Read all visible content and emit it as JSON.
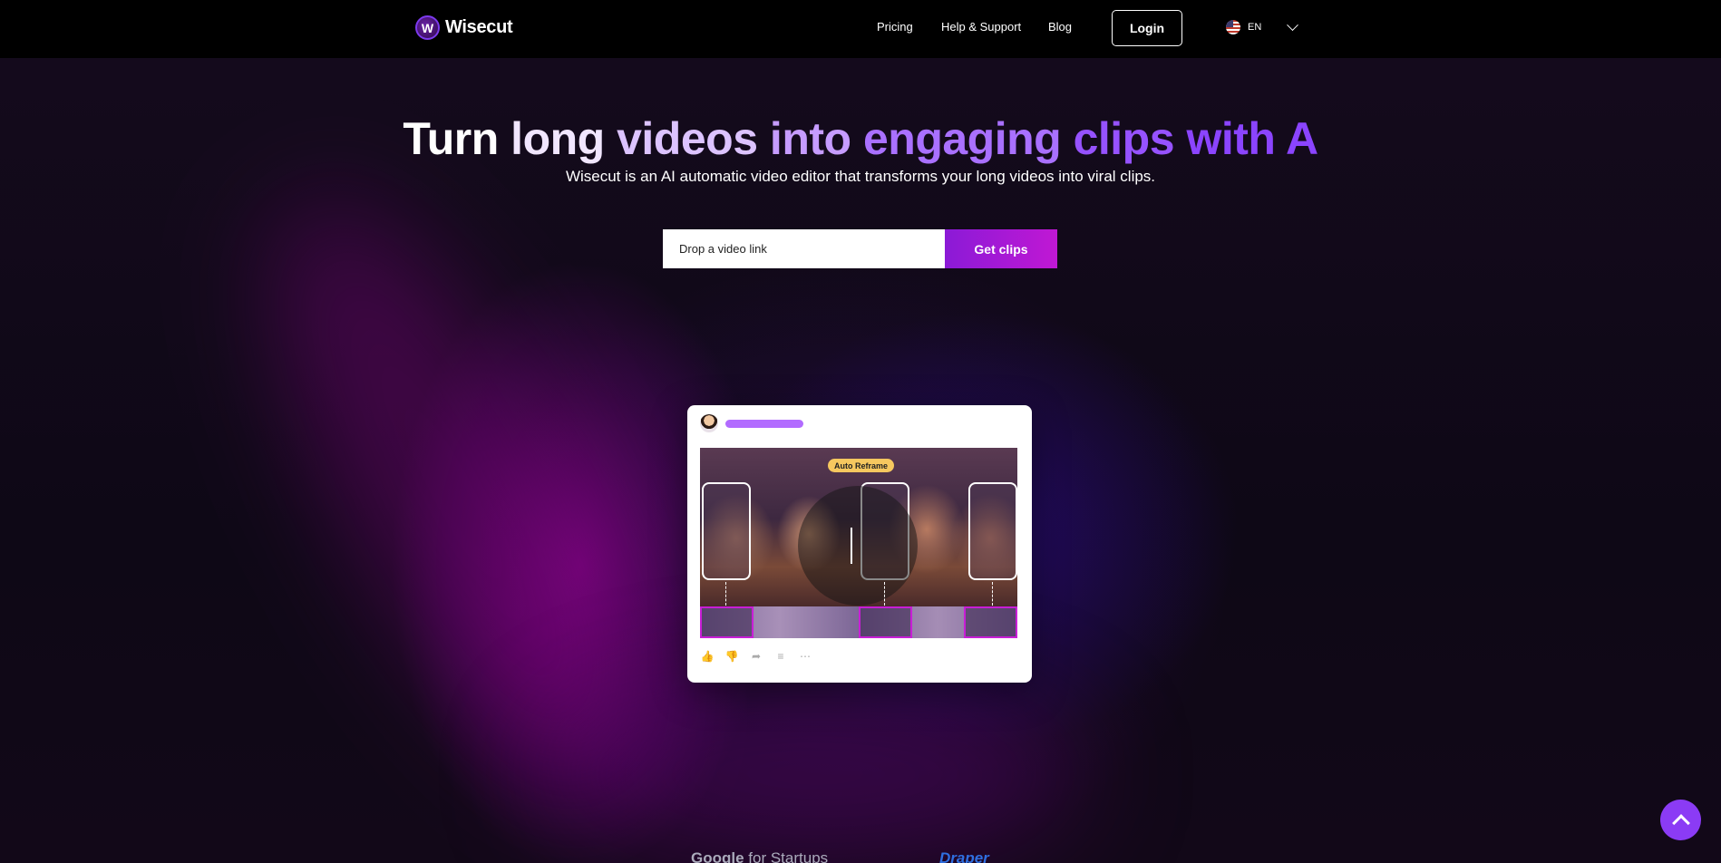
{
  "nav": {
    "brand": "Wisecut",
    "brand_mark": "W",
    "links": [
      "Pricing",
      "Help & Support",
      "Blog"
    ],
    "login_label": "Login",
    "language": "EN"
  },
  "hero": {
    "headline_words": [
      "Turn",
      "long",
      "videos",
      "into",
      "engaging",
      "clips",
      "with",
      "A"
    ],
    "subtitle": "Wisecut is an AI automatic video editor that transforms your long videos into viral clips.",
    "input_placeholder": "Drop a video link",
    "cta_label": "Get clips"
  },
  "preview": {
    "badge": "Auto Reframe",
    "actions": [
      "thumbs-up-icon",
      "thumbs-down-icon",
      "share-icon",
      "save-icon",
      "more-icon"
    ]
  },
  "partners": {
    "google": {
      "google": "Google",
      "suffix": " for Startups"
    },
    "draper": "Draper"
  },
  "colors": {
    "accent": "#8b3bf5",
    "cta_start": "#8b1ad6",
    "cta_end": "#c018d4",
    "clip_border": "#c81ed6",
    "badge": "#f6c85f"
  }
}
